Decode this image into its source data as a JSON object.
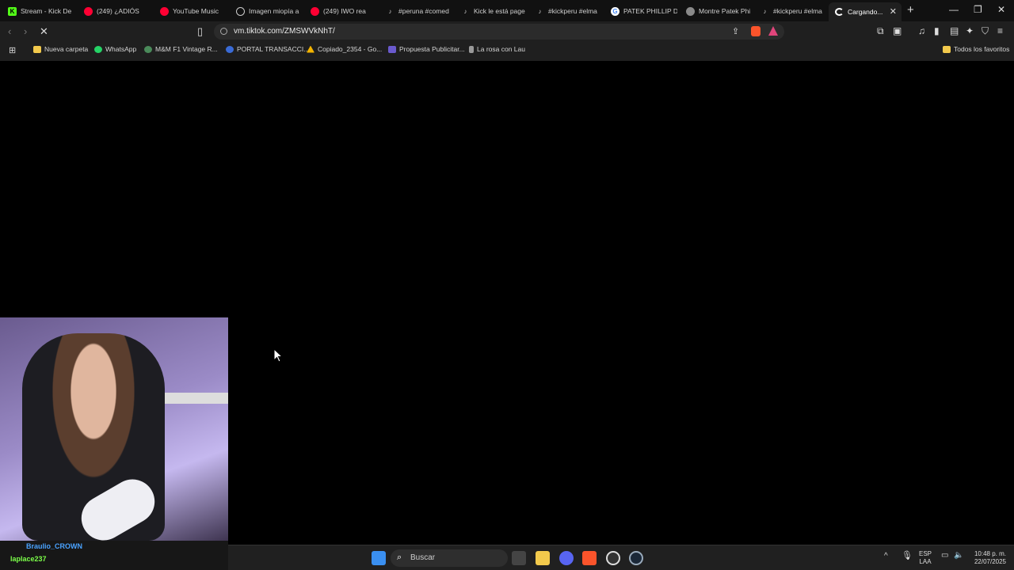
{
  "tabs": [
    {
      "title": "Stream - Kick De",
      "icon": "kick-icon",
      "color": "#53fc18"
    },
    {
      "title": "(249) ¿ADIÓS",
      "icon": "youtube-icon",
      "color": "#ff0033"
    },
    {
      "title": "YouTube Music",
      "icon": "youtube-music-icon",
      "color": "#ff0033"
    },
    {
      "title": "Imagen miopía a",
      "icon": "chatgpt-icon",
      "color": "#cccccc"
    },
    {
      "title": "(249) IWO rea",
      "icon": "youtube-icon",
      "color": "#ff0033"
    },
    {
      "title": "#peruna #comed",
      "icon": "tiktok-icon",
      "color": "#ffffff"
    },
    {
      "title": "Kick le está page",
      "icon": "tiktok-icon",
      "color": "#ffffff"
    },
    {
      "title": "#kickperu #elma",
      "icon": "tiktok-icon",
      "color": "#ffffff"
    },
    {
      "title": "PATEK PHILLIP D",
      "icon": "google-icon",
      "color": "#4285f4"
    },
    {
      "title": "Montre Patek Phi",
      "icon": "site-icon",
      "color": "#8a8a8a"
    },
    {
      "title": "#kickperu #elma",
      "icon": "tiktok-icon",
      "color": "#ffffff"
    },
    {
      "title": "Cargando...",
      "icon": "loading-spinner-icon",
      "color": "#ffffff"
    }
  ],
  "address": {
    "url": "vm.tiktok.com/ZMSWVkNhT/"
  },
  "bookmarks": [
    {
      "label": "Nueva carpeta",
      "icon": "folder-icon",
      "color": "#f2c94c"
    },
    {
      "label": "WhatsApp",
      "icon": "whatsapp-icon",
      "color": "#25d366"
    },
    {
      "label": "M&M F1 Vintage R...",
      "icon": "site-icon",
      "color": "#4a8a5a"
    },
    {
      "label": "PORTAL TRANSACCI...",
      "icon": "site-icon",
      "color": "#3a6bd6"
    },
    {
      "label": "Copiado_2354 - Go...",
      "icon": "drive-icon",
      "color": "#f4b400"
    },
    {
      "label": "Propuesta Publicitar...",
      "icon": "site-icon",
      "color": "#6a5acd"
    },
    {
      "label": "La rosa con Lau",
      "icon": "site-icon",
      "color": "#999999"
    }
  ],
  "all_favorites": "Todos los favoritos",
  "chat": [
    {
      "user": "Braulio_CROWN",
      "color": "#4aa3ff"
    },
    {
      "user": "laplace237",
      "color": "#7cff4a"
    }
  ],
  "taskbar": {
    "search_placeholder": "Buscar",
    "lang_top": "ESP",
    "lang_bottom": "LAA",
    "time": "10:48 p. m.",
    "date": "22/07/2025"
  }
}
